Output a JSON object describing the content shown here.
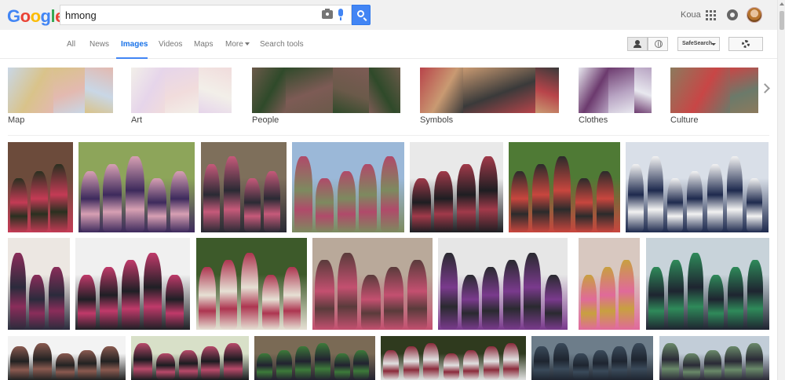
{
  "logo": {
    "letters": [
      "G",
      "o",
      "o",
      "g",
      "l",
      "e"
    ],
    "colors": [
      "#4285f4",
      "#ea4335",
      "#fbbc05",
      "#4285f4",
      "#34a853",
      "#ea4335"
    ]
  },
  "search": {
    "value": "hmong",
    "placeholder": ""
  },
  "account": {
    "name": "Koua"
  },
  "tabs": [
    {
      "label": "All",
      "active": false
    },
    {
      "label": "News",
      "active": false
    },
    {
      "label": "Images",
      "active": true
    },
    {
      "label": "Videos",
      "active": false
    },
    {
      "label": "Maps",
      "active": false
    },
    {
      "label": "More",
      "active": false
    },
    {
      "label": "Search tools",
      "active": false
    }
  ],
  "controls": {
    "safesearch_label": "SafeSearch"
  },
  "categories": [
    {
      "label": "Map",
      "palette": [
        "#c9d7e6",
        "#d9c38a",
        "#e3b9b0"
      ]
    },
    {
      "label": "Art",
      "palette": [
        "#f2efe9",
        "#e6d5ea",
        "#f1dcdc"
      ]
    },
    {
      "label": "People",
      "palette": [
        "#6b5a4a",
        "#2f4a2a",
        "#7d5b55"
      ]
    },
    {
      "label": "Symbols",
      "palette": [
        "#b8444a",
        "#c99a72",
        "#3a3a3a"
      ]
    },
    {
      "label": "Clothes",
      "palette": [
        "#e8e8ef",
        "#6c3a6e",
        "#b7a3c2"
      ]
    },
    {
      "label": "Culture",
      "palette": [
        "#8c7a5d",
        "#c84646",
        "#6b7a6a"
      ]
    }
  ],
  "results": {
    "palettes": [
      [
        "#6c4b3b",
        "#c43b55",
        "#2a3020"
      ],
      [
        "#8da55a",
        "#3d2a5c",
        "#d7a0b3"
      ],
      [
        "#7e6f5b",
        "#2a2a34",
        "#c65a7a"
      ],
      [
        "#9bb8d8",
        "#7d8a5f",
        "#b04a6a"
      ],
      [
        "#e9e9e9",
        "#1e1e22",
        "#a13a4a"
      ],
      [
        "#4f7a35",
        "#c8463e",
        "#2b2b2b"
      ],
      [
        "#d9dfe8",
        "#1e2a4e",
        "#f2f2f2"
      ],
      [
        "#ece7e2",
        "#2b2b3c",
        "#8a2d5a"
      ],
      [
        "#f0f0f0",
        "#1f1f25",
        "#c03a6a"
      ],
      [
        "#3d5a2a",
        "#e6e0d4",
        "#ad3550"
      ],
      [
        "#b9a99a",
        "#c45070",
        "#5a3b3b"
      ],
      [
        "#e6e6e6",
        "#7a3a8d",
        "#2a2a30"
      ],
      [
        "#d8c8c0",
        "#e06a9a",
        "#c8a040"
      ],
      [
        "#c8d3da",
        "#1e2430",
        "#2f8a5a"
      ],
      [
        "#f3f3f3",
        "#222",
        "#8a5a50"
      ],
      [
        "#d8e0c8",
        "#1b1b20",
        "#b84a6a"
      ],
      [
        "#7a6a55",
        "#222230",
        "#3d7a3a"
      ],
      [
        "#2f3a1e",
        "#e0e0e0",
        "#8a2a3a"
      ],
      [
        "#6d7d8a",
        "#1e2530",
        "#3a4a5a"
      ],
      [
        "#c2cdd8",
        "#2a2a36",
        "#6a8a6a"
      ]
    ]
  }
}
